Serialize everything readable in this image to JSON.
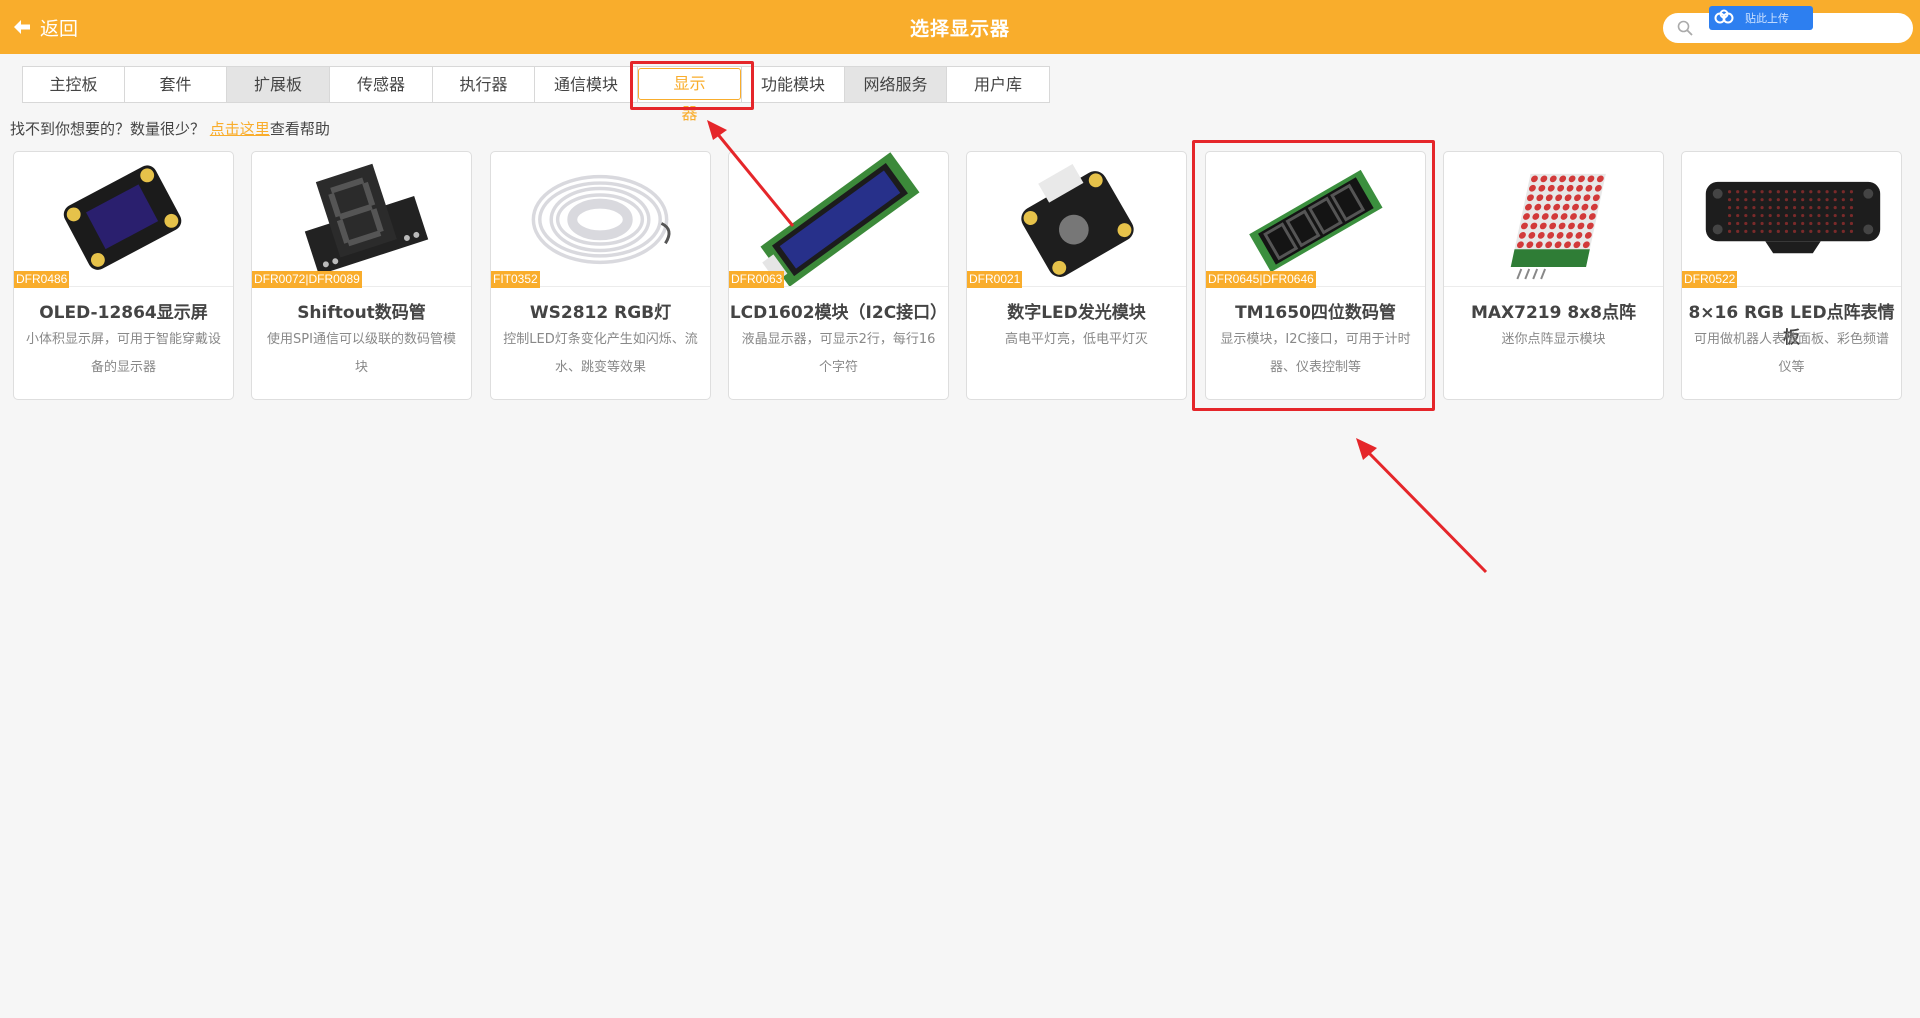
{
  "header": {
    "back_label": "返回",
    "title": "选择显示器",
    "search_placeholder": "",
    "overlay_badge_text": "贴此上传",
    "color": "#f9ad2c"
  },
  "tabs": [
    {
      "label": "主控板",
      "state": "normal"
    },
    {
      "label": "套件",
      "state": "normal"
    },
    {
      "label": "扩展板",
      "state": "shaded"
    },
    {
      "label": "传感器",
      "state": "normal"
    },
    {
      "label": "执行器",
      "state": "normal"
    },
    {
      "label": "通信模块",
      "state": "normal"
    },
    {
      "label": "显示器",
      "state": "active"
    },
    {
      "label": "功能模块",
      "state": "normal"
    },
    {
      "label": "网络服务",
      "state": "shaded"
    },
    {
      "label": "用户库",
      "state": "normal"
    }
  ],
  "help": {
    "prefix": "找不到你想要的？数量很少？",
    "link": "点击这里",
    "suffix": "查看帮助"
  },
  "cards": [
    {
      "sku": "DFR0486",
      "name": "OLED-12864显示屏",
      "desc": "小体积显示屏，可用于智能穿戴设备的显示器",
      "image": "oled-module-icon"
    },
    {
      "sku": "DFR0072|DFR0089",
      "name": "Shiftout数码管",
      "desc": "使用SPI通信可以级联的数码管模块",
      "image": "seven-segment-icon"
    },
    {
      "sku": "FIT0352",
      "name": "WS2812 RGB灯",
      "desc": "控制LED灯条变化产生如闪烁、流水、跳变等效果",
      "image": "led-strip-icon"
    },
    {
      "sku": "DFR0063",
      "name": "LCD1602模块（I2C接口）",
      "desc": "液晶显示器，可显示2行，每行16个字符",
      "image": "lcd1602-icon"
    },
    {
      "sku": "DFR0021",
      "name": "数字LED发光模块",
      "desc": "高电平灯亮，低电平灯灭",
      "image": "led-module-icon"
    },
    {
      "sku": "DFR0645|DFR0646",
      "name": "TM1650四位数码管",
      "desc": "显示模块，I2C接口，可用于计时器、仪表控制等",
      "image": "four-digit-display-icon"
    },
    {
      "sku": "",
      "name": "MAX7219 8x8点阵",
      "desc": "迷你点阵显示模块",
      "image": "dot-matrix-icon"
    },
    {
      "sku": "DFR0522",
      "name": "8×16 RGB LED点阵表情板",
      "desc": "可用做机器人表情面板、彩色频谱仪等",
      "image": "rgb-matrix-panel-icon"
    }
  ]
}
